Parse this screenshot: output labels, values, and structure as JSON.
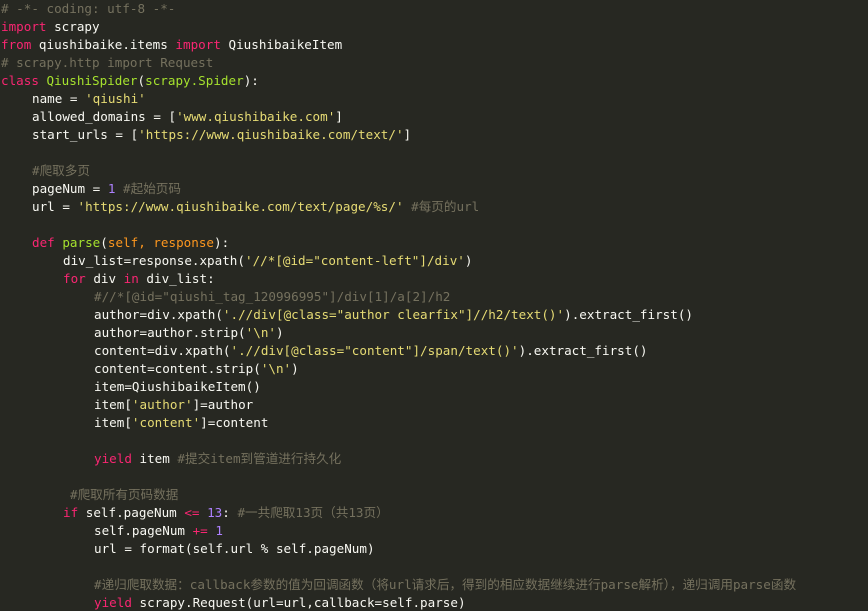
{
  "editor": {
    "background": "#272822",
    "lines": [
      {
        "indent": 0,
        "tokens": [
          {
            "t": "cmt",
            "v": "# -*- coding: utf-8 -*-"
          }
        ]
      },
      {
        "indent": 0,
        "tokens": [
          {
            "t": "kw",
            "v": "import"
          },
          {
            "t": "plain",
            "v": " scrapy"
          }
        ]
      },
      {
        "indent": 0,
        "tokens": [
          {
            "t": "kw",
            "v": "from"
          },
          {
            "t": "plain",
            "v": " qiushibaike.items "
          },
          {
            "t": "kw",
            "v": "import"
          },
          {
            "t": "plain",
            "v": " QiushibaikeItem"
          }
        ]
      },
      {
        "indent": 0,
        "tokens": [
          {
            "t": "cmt",
            "v": "# scrapy.http import Request"
          }
        ]
      },
      {
        "indent": 0,
        "tokens": [
          {
            "t": "kw",
            "v": "class"
          },
          {
            "t": "plain",
            "v": " "
          },
          {
            "t": "cls",
            "v": "QiushiSpider"
          },
          {
            "t": "plain",
            "v": "("
          },
          {
            "t": "cls",
            "v": "scrapy.Spider"
          },
          {
            "t": "plain",
            "v": "):"
          }
        ]
      },
      {
        "indent": 1,
        "tokens": [
          {
            "t": "plain",
            "v": "name = "
          },
          {
            "t": "str",
            "v": "'qiushi'"
          }
        ]
      },
      {
        "indent": 1,
        "tokens": [
          {
            "t": "plain",
            "v": "allowed_domains = ["
          },
          {
            "t": "str",
            "v": "'www.qiushibaike.com'"
          },
          {
            "t": "plain",
            "v": "]"
          }
        ]
      },
      {
        "indent": 1,
        "tokens": [
          {
            "t": "plain",
            "v": "start_urls = ["
          },
          {
            "t": "str",
            "v": "'https://www.qiushibaike.com/text/'"
          },
          {
            "t": "plain",
            "v": "]"
          }
        ]
      },
      {
        "indent": 0,
        "tokens": []
      },
      {
        "indent": 1,
        "tokens": [
          {
            "t": "cmt",
            "v": "#爬取多页"
          }
        ]
      },
      {
        "indent": 1,
        "tokens": [
          {
            "t": "plain",
            "v": "pageNum = "
          },
          {
            "t": "num",
            "v": "1"
          },
          {
            "t": "plain",
            "v": " "
          },
          {
            "t": "cmt",
            "v": "#起始页码"
          }
        ]
      },
      {
        "indent": 1,
        "tokens": [
          {
            "t": "plain",
            "v": "url = "
          },
          {
            "t": "str",
            "v": "'https://www.qiushibaike.com/text/page/%s/'"
          },
          {
            "t": "plain",
            "v": " "
          },
          {
            "t": "cmt",
            "v": "#每页的url"
          }
        ]
      },
      {
        "indent": 0,
        "tokens": []
      },
      {
        "indent": 1,
        "tokens": [
          {
            "t": "kw",
            "v": "def"
          },
          {
            "t": "plain",
            "v": " "
          },
          {
            "t": "fn",
            "v": "parse"
          },
          {
            "t": "plain",
            "v": "("
          },
          {
            "t": "param",
            "v": "self, response"
          },
          {
            "t": "plain",
            "v": "):"
          }
        ]
      },
      {
        "indent": 2,
        "tokens": [
          {
            "t": "plain",
            "v": "div_list=response.xpath("
          },
          {
            "t": "str",
            "v": "'//*[@id=\"content-left\"]/div'"
          },
          {
            "t": "plain",
            "v": ")"
          }
        ]
      },
      {
        "indent": 2,
        "tokens": [
          {
            "t": "kw",
            "v": "for"
          },
          {
            "t": "plain",
            "v": " div "
          },
          {
            "t": "kw",
            "v": "in"
          },
          {
            "t": "plain",
            "v": " div_list:"
          }
        ]
      },
      {
        "indent": 3,
        "tokens": [
          {
            "t": "cmt",
            "v": "#//*[@id=\"qiushi_tag_120996995\"]/div[1]/a[2]/h2"
          }
        ]
      },
      {
        "indent": 3,
        "tokens": [
          {
            "t": "plain",
            "v": "author=div.xpath("
          },
          {
            "t": "str",
            "v": "'.//div[@class=\"author clearfix\"]//h2/text()'"
          },
          {
            "t": "plain",
            "v": ").extract_first()"
          }
        ]
      },
      {
        "indent": 3,
        "tokens": [
          {
            "t": "plain",
            "v": "author=author.strip("
          },
          {
            "t": "str",
            "v": "'\\n'"
          },
          {
            "t": "plain",
            "v": ")"
          }
        ]
      },
      {
        "indent": 3,
        "tokens": [
          {
            "t": "plain",
            "v": "content=div.xpath("
          },
          {
            "t": "str",
            "v": "'.//div[@class=\"content\"]/span/text()'"
          },
          {
            "t": "plain",
            "v": ").extract_first()"
          }
        ]
      },
      {
        "indent": 3,
        "tokens": [
          {
            "t": "plain",
            "v": "content=content.strip("
          },
          {
            "t": "str",
            "v": "'\\n'"
          },
          {
            "t": "plain",
            "v": ")"
          }
        ]
      },
      {
        "indent": 3,
        "tokens": [
          {
            "t": "plain",
            "v": "item=QiushibaikeItem()"
          }
        ]
      },
      {
        "indent": 3,
        "tokens": [
          {
            "t": "plain",
            "v": "item["
          },
          {
            "t": "str",
            "v": "'author'"
          },
          {
            "t": "plain",
            "v": "]=author"
          }
        ]
      },
      {
        "indent": 3,
        "tokens": [
          {
            "t": "plain",
            "v": "item["
          },
          {
            "t": "str",
            "v": "'content'"
          },
          {
            "t": "plain",
            "v": "]=content"
          }
        ]
      },
      {
        "indent": 0,
        "tokens": []
      },
      {
        "indent": 3,
        "tokens": [
          {
            "t": "kw",
            "v": "yield"
          },
          {
            "t": "plain",
            "v": " item "
          },
          {
            "t": "cmt",
            "v": "#提交item到管道进行持久化"
          }
        ]
      },
      {
        "indent": 0,
        "tokens": []
      },
      {
        "indent": 5,
        "tokens": [
          {
            "t": "cmt",
            "v": "#爬取所有页码数据"
          }
        ]
      },
      {
        "indent": 2,
        "tokens": [
          {
            "t": "kw",
            "v": "if"
          },
          {
            "t": "plain",
            "v": " self.pageNum "
          },
          {
            "t": "op",
            "v": "<="
          },
          {
            "t": "plain",
            "v": " "
          },
          {
            "t": "num",
            "v": "13"
          },
          {
            "t": "plain",
            "v": ": "
          },
          {
            "t": "cmt",
            "v": "#一共爬取13页（共13页）"
          }
        ]
      },
      {
        "indent": 3,
        "tokens": [
          {
            "t": "plain",
            "v": "self.pageNum "
          },
          {
            "t": "op",
            "v": "+="
          },
          {
            "t": "plain",
            "v": " "
          },
          {
            "t": "num",
            "v": "1"
          }
        ]
      },
      {
        "indent": 3,
        "tokens": [
          {
            "t": "plain",
            "v": "url = format(self.url % self.pageNum)"
          }
        ]
      },
      {
        "indent": 0,
        "tokens": []
      },
      {
        "indent": 3,
        "tokens": [
          {
            "t": "cmt",
            "v": "#递归爬取数据：callback参数的值为回调函数（将url请求后，得到的相应数据继续进行parse解析），递归调用parse函数"
          }
        ]
      },
      {
        "indent": 3,
        "tokens": [
          {
            "t": "kw",
            "v": "yield"
          },
          {
            "t": "plain",
            "v": " scrapy.Request(url=url,callback=self.parse)"
          }
        ]
      }
    ]
  }
}
